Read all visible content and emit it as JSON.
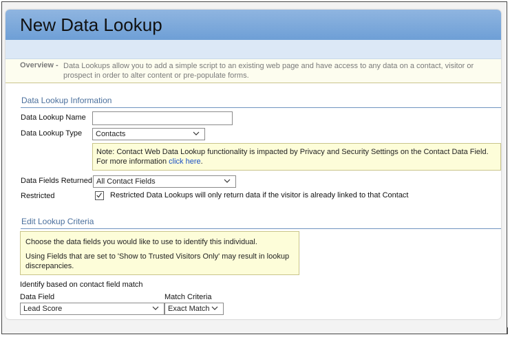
{
  "dialog": {
    "title": "New Data Lookup"
  },
  "overview": {
    "label": "Overview -",
    "text": "Data Lookups allow you to add a simple script to an existing web page and have access to any data on a contact, visitor or prospect in order to alter content or pre-populate forms."
  },
  "info_section": {
    "heading": "Data Lookup Information",
    "name_label": "Data Lookup Name",
    "name_value": "",
    "type_label": "Data Lookup Type",
    "type_value": "Contacts",
    "note_text": "Note: Contact Web Data Lookup functionality is impacted by Privacy and Security Settings on the Contact Data Field. For more information",
    "note_link": "click here",
    "note_end": ".",
    "fields_label": "Data Fields Returned",
    "fields_value": "All Contact Fields",
    "restricted_label": "Restricted",
    "restricted_checked": true,
    "restricted_text": "Restricted Data Lookups will only return data if the visitor is already linked to that Contact"
  },
  "criteria_section": {
    "heading": "Edit Lookup Criteria",
    "instruction_1": "Choose the data fields you would like to use to identify this individual.",
    "instruction_2": "Using Fields that are set to 'Show to Trusted Visitors Only' may result in lookup discrepancies.",
    "identify_label": "Identify based on contact field match",
    "data_field_label": "Data Field",
    "data_field_value": "Lead Score",
    "match_label": "Match Criteria",
    "match_value": "Exact Match"
  }
}
